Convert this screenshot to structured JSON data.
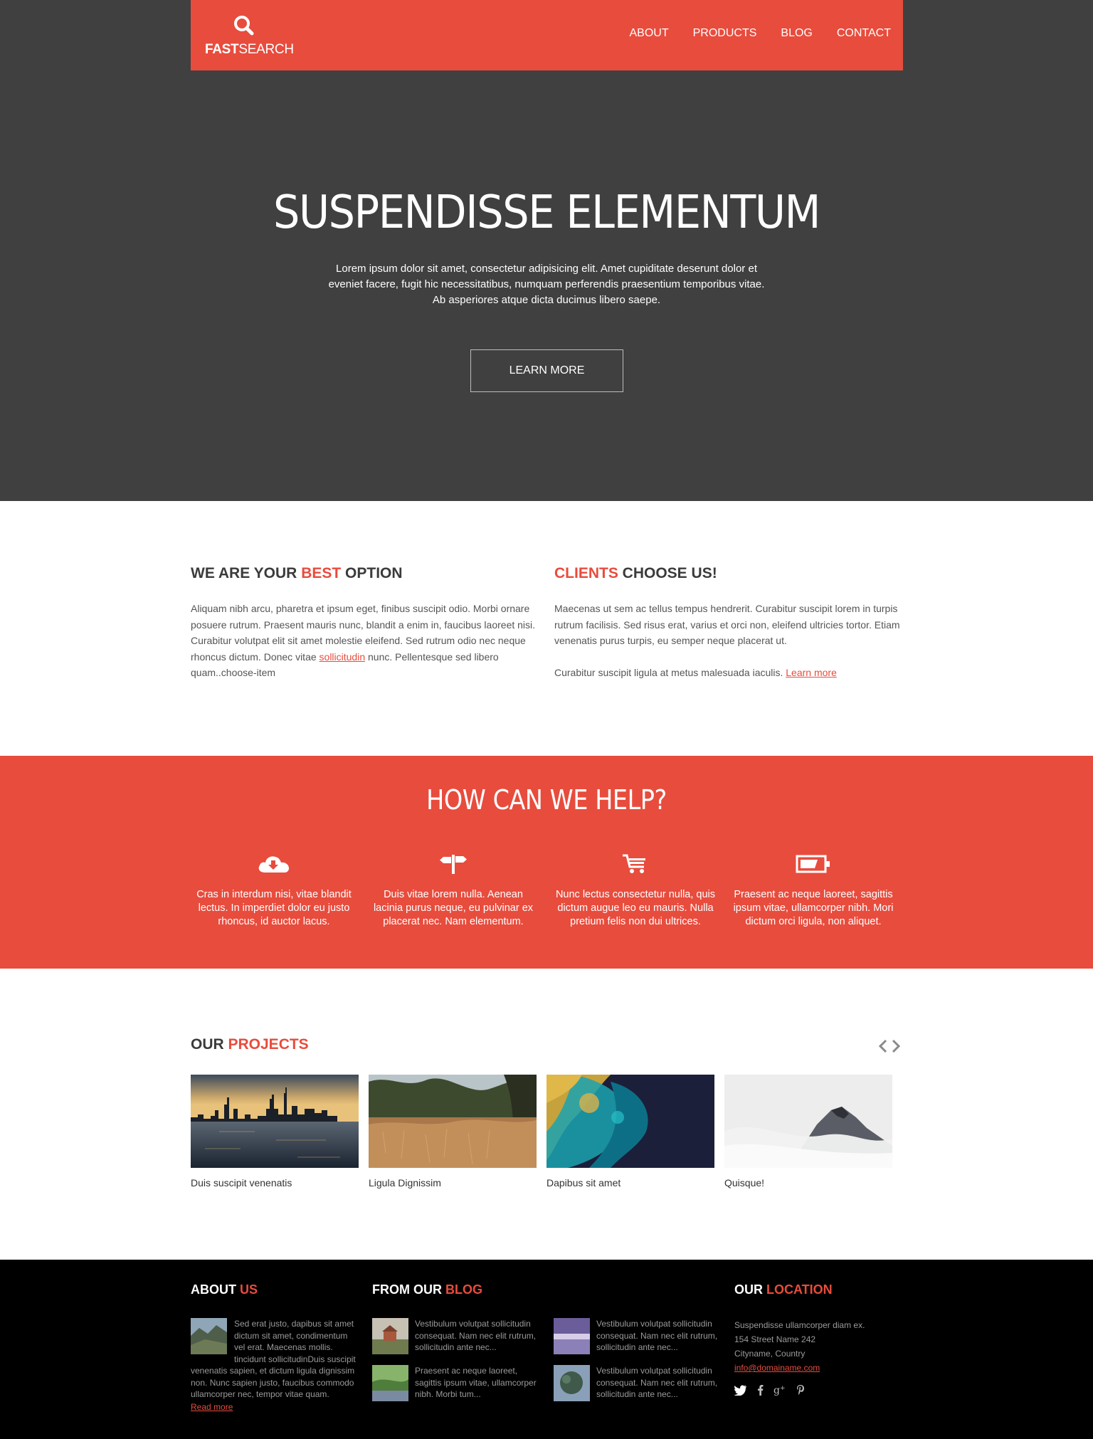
{
  "brand": {
    "bold": "FAST",
    "light": "SEARCH"
  },
  "nav": [
    "ABOUT",
    "PRODUCTS",
    "BLOG",
    "CONTACT"
  ],
  "hero": {
    "title": "SUSPENDISSE ELEMENTUM",
    "text": "Lorem ipsum dolor sit amet, consectetur adipisicing elit. Amet cupiditate deserunt dolor et eveniet facere, fugit hic necessitatibus, numquam perferendis praesentium temporibus vitae. Ab asperiores atque dicta ducimus libero saepe.",
    "button": "LEARN MORE"
  },
  "options": {
    "left": {
      "title_pre": "WE ARE YOUR ",
      "title_accent": "BEST",
      "title_post": " OPTION",
      "text_pre": "Aliquam nibh arcu, pharetra et ipsum eget, finibus suscipit odio. Morbi ornare posuere rutrum. Praesent mauris nunc, blandit a enim in, faucibus laoreet nisi. Curabitur volutpat elit sit amet molestie eleifend. Sed rutrum odio nec neque rhoncus dictum. Donec vitae ",
      "link": "sollicitudin",
      "text_post": " nunc. Pellentesque sed libero quam..choose-item"
    },
    "right": {
      "title_accent": "CLIENTS",
      "title_post": " CHOOSE US!",
      "text1": "Maecenas ut sem ac tellus tempus hendrerit. Curabitur suscipit lorem in turpis rutrum facilisis. Sed risus erat, varius et orci non, eleifend ultricies tortor. Etiam venenatis purus turpis, eu semper neque placerat ut.",
      "text2": "Curabitur suscipit ligula at metus malesuada iaculis. ",
      "link": "Learn more"
    }
  },
  "help": {
    "title": "HOW CAN WE HELP?",
    "items": [
      {
        "icon": "cloud-download-icon",
        "text": "Cras in interdum nisi, vitae blandit lectus. In imperdiet dolor eu justo rhoncus, id auctor lacus."
      },
      {
        "icon": "signpost-icon",
        "text": "Duis vitae lorem nulla. Aenean lacinia purus neque, eu pulvinar ex placerat nec. Nam elementum."
      },
      {
        "icon": "shopping-cart-icon",
        "text": "Nunc lectus consectetur nulla, quis dictum augue leo eu mauris. Nulla pretium felis non dui ultrices."
      },
      {
        "icon": "battery-icon",
        "text": "Praesent ac neque laoreet, sagittis ipsum vitae, ullamcorper nibh. Mori dictum orci ligula, non aliquet."
      }
    ]
  },
  "projects": {
    "title_pre": "OUR ",
    "title_accent": "PROJECTS",
    "items": [
      {
        "caption": "Duis suscipit venenatis"
      },
      {
        "caption": "Ligula Dignissim"
      },
      {
        "caption": "Dapibus sit amet"
      },
      {
        "caption": "Quisque!"
      }
    ]
  },
  "footer": {
    "about": {
      "title_pre": "ABOUT ",
      "title_accent": "US",
      "text": "Sed erat justo, dapibus sit amet dictum sit amet, condimentum vel erat. Maecenas mollis. tincidunt sollicitudinDuis suscipit venenatis sapien, et dictum ligula dignissim non. Nunc sapien justo, faucibus commodo ullamcorper nec, tempor vitae quam.",
      "link": "Read more"
    },
    "blog": {
      "title_pre": "FROM OUR ",
      "title_accent": "BLOG",
      "posts": [
        "Vestibulum volutpat sollicitudin consequat. Nam nec elit rutrum, sollicitudin ante nec...",
        "Vestibulum volutpat sollicitudin consequat. Nam nec elit rutrum, sollicitudin ante nec...",
        "Praesent ac neque laoreet, sagittis ipsum vitae, ullamcorper nibh. Morbi tum...",
        "Vestibulum volutpat sollicitudin consequat. Nam nec elit rutrum, sollicitudin ante nec..."
      ]
    },
    "location": {
      "title_pre": "OUR ",
      "title_accent": "LOCATION",
      "line1": "Suspendisse ullamcorper diam ex.",
      "line2": "154 Street Name 242",
      "line3": "Cityname, Country",
      "email": "info@domainame.com"
    },
    "social": [
      "twitter-icon",
      "facebook-icon",
      "google-plus-icon",
      "pinterest-icon"
    ]
  },
  "colors": {
    "accent": "#e84c3d",
    "hero_bg": "#404040",
    "footer_bg": "#000000"
  }
}
